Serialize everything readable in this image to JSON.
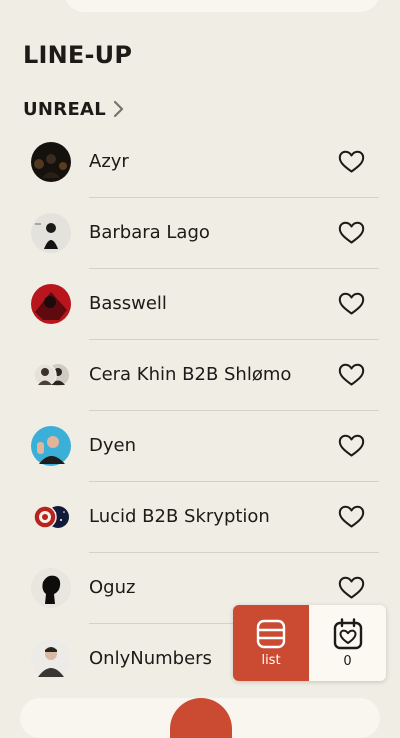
{
  "page": {
    "title": "LINE-UP"
  },
  "section": {
    "title": "UNREAL"
  },
  "artists": [
    {
      "name": "Azyr",
      "avatar": "azyr-photo",
      "favorite": false
    },
    {
      "name": "Barbara Lago",
      "avatar": "barbara-lago-photo",
      "favorite": false
    },
    {
      "name": "Basswell",
      "avatar": "basswell-photo",
      "favorite": false
    },
    {
      "name": "Cera Khin B2B Shlømo",
      "avatar": "cera-khin-shlomo-photos",
      "favorite": false
    },
    {
      "name": "Dyen",
      "avatar": "dyen-photo",
      "favorite": false
    },
    {
      "name": "Lucid B2B Skryption",
      "avatar": "lucid-skryption-photos",
      "favorite": false
    },
    {
      "name": "Oguz",
      "avatar": "oguz-photo",
      "favorite": false
    },
    {
      "name": "OnlyNumbers",
      "avatar": "onlynumbers-photo",
      "favorite": false
    }
  ],
  "view_toggle": {
    "list_label": "list",
    "favorites_count": "0",
    "active": "list"
  },
  "icons": {
    "section_link": "chevron-right-icon",
    "favorite": "heart-outline-icon",
    "list_view": "list-icon",
    "favorites_view": "calendar-heart-icon"
  },
  "colors": {
    "background": "#efede4",
    "accent": "#cb4a32",
    "text": "#1d1b18",
    "divider": "#d4d1c6"
  }
}
